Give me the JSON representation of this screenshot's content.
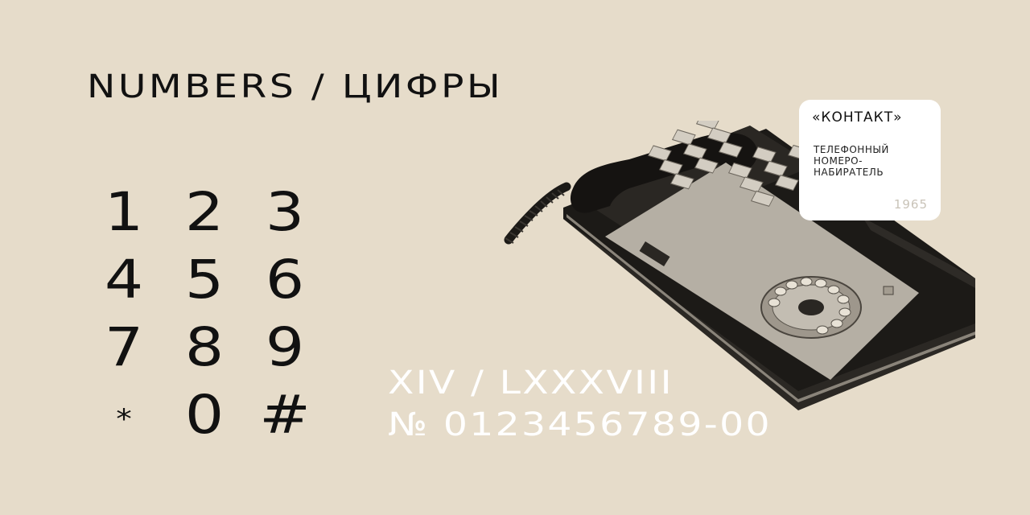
{
  "heading": "NUMBERS / ЦИФРЫ",
  "keypad": {
    "keys": [
      "1",
      "2",
      "3",
      "4",
      "5",
      "6",
      "7",
      "8",
      "9",
      "*",
      "0",
      "#"
    ]
  },
  "roman_line": "XIV / LXXXVIII",
  "serial_line": "№ 0123456789-00",
  "card": {
    "title": "«КОНТАКТ»",
    "description": [
      "ТЕЛЕФОННЫЙ",
      "НОМЕРО-",
      "НАБИРАТЕЛЬ"
    ],
    "year": "1965"
  },
  "photo": {
    "subject": "telephone-number-dialer",
    "colors": {
      "background": "#e6dcca",
      "phone_body": "#1c1a17",
      "panel": "#b5afa4",
      "buttons": "#d3cdc2"
    }
  }
}
